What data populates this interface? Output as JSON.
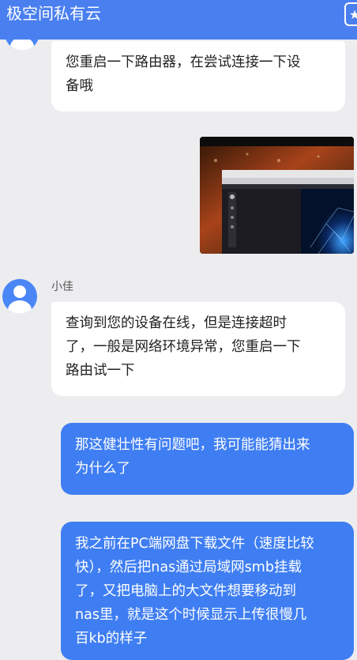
{
  "header": {
    "title": "极空间私有云",
    "star_icon": "star-icon"
  },
  "messages": [
    {
      "side": "left",
      "lines": [
        "您重启一下路由器，在尝试连接一下设",
        "备哦"
      ]
    },
    {
      "side": "right",
      "type": "image",
      "content": "screenshot-thumbnail"
    },
    {
      "side": "left",
      "sender": "小佳",
      "lines": [
        "查询到您的设备在线，但是连接超时",
        "了，一般是网络环境异常，您重启一下",
        "路由试一下"
      ]
    },
    {
      "side": "right",
      "lines": [
        "那这健壮性有问题吧，我可能能猜出来",
        "为什么了"
      ]
    },
    {
      "side": "right",
      "lines": [
        "我之前在PC端网盘下载文件（速度比较",
        "快），然后把nas通过局域网smb挂载",
        "了，又把电脑上的大文件想要移动到",
        "nas里，就是这个时候显示上传很慢几",
        "百kb的样子"
      ]
    }
  ],
  "colors": {
    "header": "#4a7ff0",
    "background": "#ededef",
    "bubble_left": "#ffffff",
    "bubble_right": "#3f7ef2"
  }
}
